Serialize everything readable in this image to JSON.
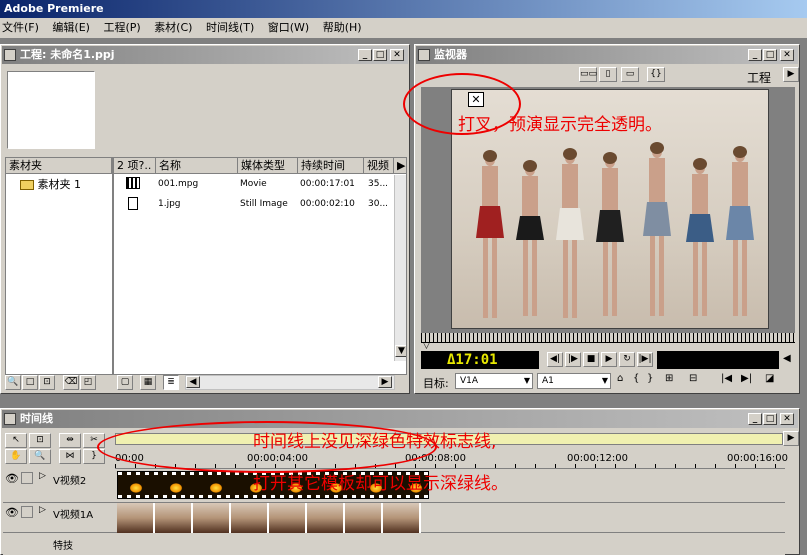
{
  "app": {
    "title": "Adobe Premiere"
  },
  "menu": [
    "文件(F)",
    "编辑(E)",
    "工程(P)",
    "素材(C)",
    "时间线(T)",
    "窗口(W)",
    "帮助(H)"
  ],
  "project": {
    "title": "工程: 未命名1.ppj",
    "bins_header": "素材夹",
    "bin_item": "素材夹 1",
    "item_count_header": "2 项?..",
    "columns": [
      "名称",
      "媒体类型",
      "持续时间",
      "视频"
    ],
    "rows": [
      {
        "name": "001.mpg",
        "type": "Movie",
        "duration": "00:00:17:01",
        "video": "35..."
      },
      {
        "name": "1.jpg",
        "type": "Still Image",
        "duration": "00:00:02:10",
        "video": "30..."
      }
    ]
  },
  "monitor": {
    "title": "监视器",
    "tab": "工程",
    "timecode": "Δ17:01",
    "target_label": "目标:",
    "video_target": "V1A",
    "audio_target": "A1",
    "annotation": "打叉，预演显示完全透明。"
  },
  "timeline": {
    "title": "时间线",
    "ruler": [
      "00:00",
      "00:00:04:00",
      "00:00:08:00",
      "00:00:12:00",
      "00:00:16:00"
    ],
    "tracks": [
      {
        "label": "V视频2"
      },
      {
        "label": "V视频1A"
      },
      {
        "label": "特技"
      }
    ],
    "annotation_line1": "时间线上没见深绿色特效标志线,",
    "annotation_line2": "打开其它模板却可以显示深绿线。"
  },
  "colors": {
    "titlebar_active": "#0a246a",
    "annotation": "#e00000",
    "lcd_text": "#e8e800"
  }
}
